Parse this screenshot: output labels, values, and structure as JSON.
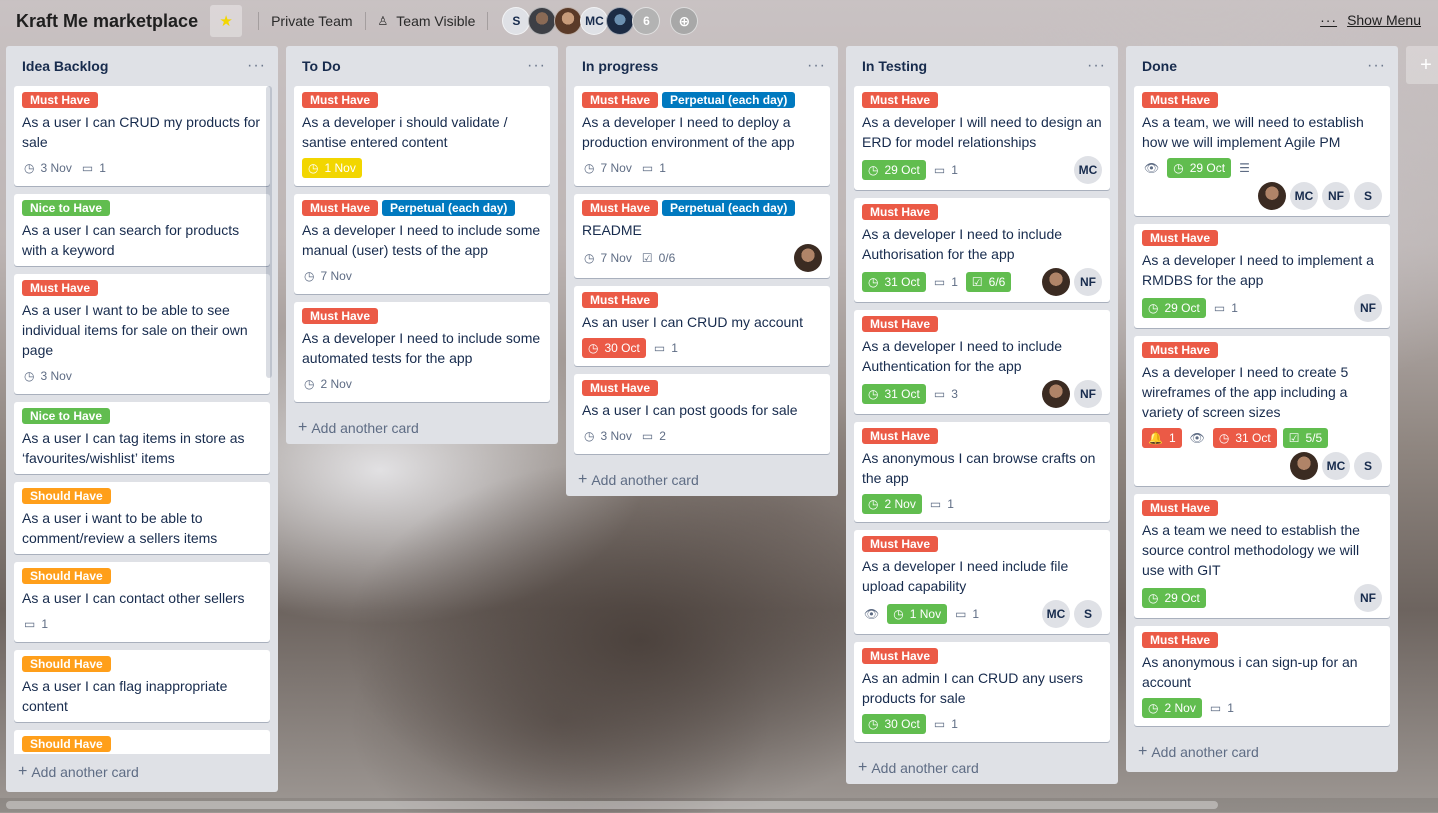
{
  "header": {
    "board_title": "Kraft Me marketplace",
    "star_icon": "★",
    "team": "Private Team",
    "visibility": "Team Visible",
    "members": [
      "S",
      "",
      "",
      "MC",
      ""
    ],
    "member_count": "6",
    "show_menu": "Show Menu",
    "dots": "···"
  },
  "add_card_label": "Add another card",
  "lists": [
    {
      "title": "Idea Backlog",
      "cards": [
        {
          "labels": [
            {
              "text": "Must Have",
              "color": "red"
            }
          ],
          "title": "As a user I can CRUD my products for sale",
          "due": "3 Nov",
          "comments": "1"
        },
        {
          "labels": [
            {
              "text": "Nice to Have",
              "color": "green"
            }
          ],
          "title": "As a user I can search for products with a keyword"
        },
        {
          "labels": [
            {
              "text": "Must Have",
              "color": "red"
            }
          ],
          "title": "As a user I want to be able to see individual items for sale on their own page",
          "due": "3 Nov"
        },
        {
          "labels": [
            {
              "text": "Nice to Have",
              "color": "green"
            }
          ],
          "title": "As a user I can tag items in store as ‘favourites/wishlist’ items"
        },
        {
          "labels": [
            {
              "text": "Should Have",
              "color": "orange"
            }
          ],
          "title": "As a user i want to be able to comment/review a sellers items"
        },
        {
          "labels": [
            {
              "text": "Should Have",
              "color": "orange"
            }
          ],
          "title": "As a user I can contact other sellers",
          "comments": "1"
        },
        {
          "labels": [
            {
              "text": "Should Have",
              "color": "orange"
            }
          ],
          "title": "As a user I can flag inappropriate content"
        },
        {
          "labels": [
            {
              "text": "Should Have",
              "color": "orange"
            }
          ],
          "title": ""
        }
      ]
    },
    {
      "title": "To Do",
      "cards": [
        {
          "labels": [
            {
              "text": "Must Have",
              "color": "red"
            }
          ],
          "title": "As a developer i should validate / santise entered content",
          "due": "1 Nov"
        },
        {
          "labels": [
            {
              "text": "Must Have",
              "color": "red"
            },
            {
              "text": "Perpetual (each day)",
              "color": "blue"
            }
          ],
          "title": "As a developer I need to include some manual (user) tests of the app",
          "due": "7 Nov"
        },
        {
          "labels": [
            {
              "text": "Must Have",
              "color": "red"
            }
          ],
          "title": "As a developer I need to include some automated tests for the app",
          "due": "2 Nov"
        }
      ]
    },
    {
      "title": "In progress",
      "cards": [
        {
          "labels": [
            {
              "text": "Must Have",
              "color": "red"
            },
            {
              "text": "Perpetual (each day)",
              "color": "blue"
            }
          ],
          "title": "As a developer I need to deploy a production environment of the app",
          "due": "7 Nov",
          "comments": "1"
        },
        {
          "labels": [
            {
              "text": "Must Have",
              "color": "red"
            },
            {
              "text": "Perpetual (each day)",
              "color": "blue"
            }
          ],
          "title": "README",
          "due": "7 Nov",
          "checklist": "0/6"
        },
        {
          "labels": [
            {
              "text": "Must Have",
              "color": "red"
            }
          ],
          "title": "As an user I can CRUD my account",
          "due": "30 Oct",
          "comments": "1"
        },
        {
          "labels": [
            {
              "text": "Must Have",
              "color": "red"
            }
          ],
          "title": "As a user I can post goods for sale",
          "due": "3 Nov",
          "comments": "2"
        }
      ]
    },
    {
      "title": "In Testing",
      "cards": [
        {
          "labels": [
            {
              "text": "Must Have",
              "color": "red"
            }
          ],
          "title": "As a developer I will need to design an ERD for model relationships",
          "due": "29 Oct",
          "comments": "1",
          "members": [
            "MC"
          ]
        },
        {
          "labels": [
            {
              "text": "Must Have",
              "color": "red"
            }
          ],
          "title": "As a developer I need to include Authorisation for the app",
          "due": "31 Oct",
          "comments": "1",
          "checklist": "6/6",
          "members": [
            "",
            "NF"
          ]
        },
        {
          "labels": [
            {
              "text": "Must Have",
              "color": "red"
            }
          ],
          "title": "As a developer I need to include Authentication for the app",
          "due": "31 Oct",
          "comments": "3",
          "members": [
            "",
            "NF"
          ]
        },
        {
          "labels": [
            {
              "text": "Must Have",
              "color": "red"
            }
          ],
          "title": "As anonymous I can browse crafts on the app",
          "due": "2 Nov",
          "comments": "1"
        },
        {
          "labels": [
            {
              "text": "Must Have",
              "color": "red"
            }
          ],
          "title": "As a developer I need include file upload capability",
          "due": "1 Nov",
          "comments": "1",
          "members": [
            "MC",
            "S"
          ]
        },
        {
          "labels": [
            {
              "text": "Must Have",
              "color": "red"
            }
          ],
          "title": "As an admin I can CRUD any users products for sale",
          "due": "30 Oct",
          "comments": "1"
        }
      ]
    },
    {
      "title": "Done",
      "cards": [
        {
          "labels": [
            {
              "text": "Must Have",
              "color": "red"
            }
          ],
          "title": "As a team, we will need to establish how we will implement Agile PM",
          "due": "29 Oct",
          "members": [
            "",
            "MC",
            "NF",
            "S"
          ]
        },
        {
          "labels": [
            {
              "text": "Must Have",
              "color": "red"
            }
          ],
          "title": "As a developer I need to implement a RMDBS for the app",
          "due": "29 Oct",
          "comments": "1",
          "members": [
            "NF"
          ]
        },
        {
          "labels": [
            {
              "text": "Must Have",
              "color": "red"
            }
          ],
          "title": "As a developer I need to create 5 wireframes of the app including a variety of screen sizes",
          "notifications": "1",
          "due": "31 Oct",
          "checklist": "5/5",
          "members": [
            "",
            "MC",
            "S"
          ]
        },
        {
          "labels": [
            {
              "text": "Must Have",
              "color": "red"
            }
          ],
          "title": "As a team we need to establish the source control methodology we will use with GIT",
          "due": "29 Oct",
          "members": [
            "NF"
          ]
        },
        {
          "labels": [
            {
              "text": "Must Have",
              "color": "red"
            }
          ],
          "title": "As anonymous i can sign-up for an account",
          "due": "2 Nov",
          "comments": "1"
        }
      ]
    }
  ]
}
